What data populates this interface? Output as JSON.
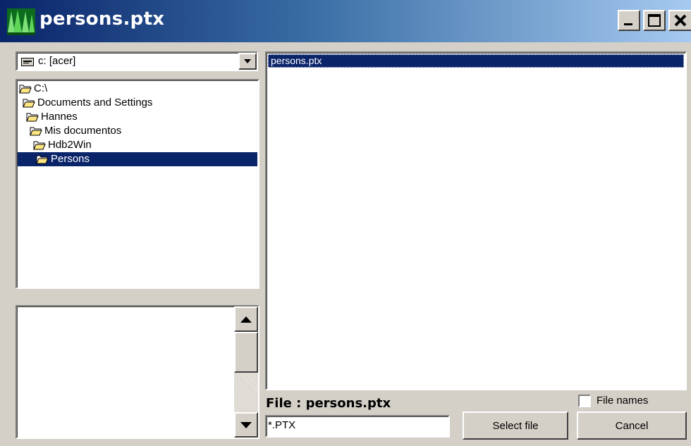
{
  "window": {
    "title": "persons.ptx",
    "controls": {
      "minimize": "minimize-icon",
      "maximize": "maximize-icon",
      "close": "close-icon"
    }
  },
  "drive_select": {
    "value": "c: [acer]",
    "icon": "drive-icon"
  },
  "folder_tree": {
    "items": [
      {
        "label": "C:\\",
        "indent": 0,
        "selected": false
      },
      {
        "label": "Documents and Settings",
        "indent": 1,
        "selected": false
      },
      {
        "label": "Hannes",
        "indent": 2,
        "selected": false
      },
      {
        "label": "Mis documentos",
        "indent": 3,
        "selected": false
      },
      {
        "label": "Hdb2Win",
        "indent": 4,
        "selected": false
      },
      {
        "label": "Persons",
        "indent": 5,
        "selected": true
      }
    ]
  },
  "file_list": {
    "items": [
      {
        "label": "persons.ptx",
        "selected": true
      }
    ]
  },
  "file_label": "File : persons.ptx",
  "filter_input": {
    "value": "*.PTX"
  },
  "file_names_checkbox": {
    "label": "File names",
    "checked": false
  },
  "buttons": {
    "select_file": "Select file",
    "cancel": "Cancel"
  },
  "colors": {
    "selection": "#0a246a",
    "face": "#d4d0c8"
  }
}
